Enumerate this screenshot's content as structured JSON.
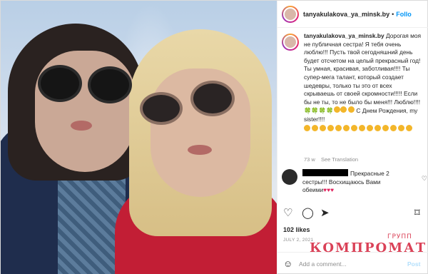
{
  "post": {
    "username": "tanyakulakova_ya_minsk.by",
    "follow_label": "Follo",
    "separator": "•",
    "caption_user": "tanyakulakova_ya_minsk.by",
    "caption_text": "Дорогая моя не публичная сестра! Я тебя очень люблю!!! Пусть твой сегодняшний день будет отсчетом на целый прекрасный год! Ты умная, красивая, заботливая!!!! Ты супер-мега талант, который создает шедевры, только ты это от всех скрываешь от своей скромности!!!!! Если бы не ты, то не было бы меня!!! Люблю!!!!",
    "caption_tail": "С Днем Рождения, my sister!!!!",
    "caption_age": "73 w",
    "see_translation": "See Translation",
    "comment_text": "Прекрасные 2 сестры!!! Восхищаюсь Вами обеими",
    "comment_hearts": "♥♥♥",
    "likes": "102 likes",
    "date": "JULY 2, 2021",
    "add_comment_placeholder": "Add a comment...",
    "post_label": "Post"
  },
  "icons": {
    "like": "heart-icon",
    "comment": "comment-icon",
    "share": "share-icon",
    "save": "bookmark-icon",
    "emoji": "smile-icon"
  },
  "watermark": {
    "top": "ГРУПП",
    "main": "КОМПРОМАТ"
  },
  "colors": {
    "follow": "#0095f6",
    "watermark": "#d4203a"
  }
}
